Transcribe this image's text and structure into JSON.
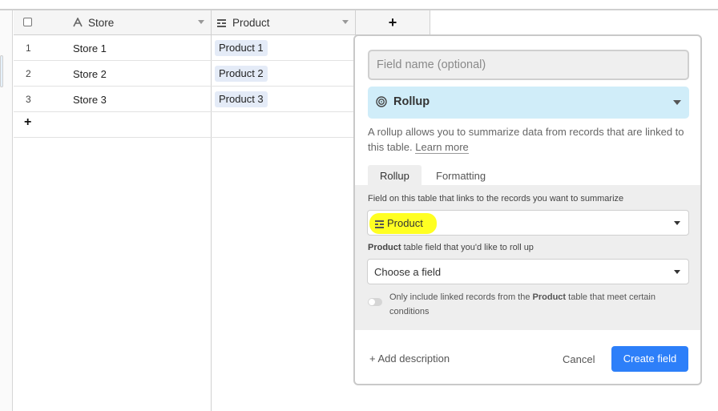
{
  "grid": {
    "header": {
      "store_label": "Store",
      "product_label": "Product",
      "add_column": "+"
    },
    "rows": [
      {
        "num": "1",
        "store": "Store 1",
        "product": "Product 1"
      },
      {
        "num": "2",
        "store": "Store 2",
        "product": "Product 2"
      },
      {
        "num": "3",
        "store": "Store 3",
        "product": "Product 3"
      }
    ],
    "add_row": "+"
  },
  "dialog": {
    "field_name_placeholder": "Field name (optional)",
    "field_type": "Rollup",
    "description": "A rollup allows you to summarize data from records that are linked to this table.",
    "learn_more": "Learn more",
    "tabs": [
      "Rollup",
      "Formatting"
    ],
    "link_field_label": "Field on this table that links to the records you want to summarize",
    "link_field_value": "Product",
    "rollup_field_label_bold": "Product",
    "rollup_field_label_rest": " table field that you'd like to roll up",
    "rollup_field_placeholder": "Choose a field",
    "condition_prefix": "Only include linked records from the ",
    "condition_bold": "Product",
    "condition_suffix": " table that meet certain conditions",
    "add_description": "+ Add description",
    "cancel": "Cancel",
    "create": "Create field"
  },
  "colors": {
    "primary_button": "#2d7ff9",
    "type_select_bg": "#d0edf9",
    "highlight": "#ffff22",
    "linked_pill_bg": "#e4ebf7"
  },
  "icons": [
    "checkbox-icon",
    "text-field-icon",
    "linked-record-icon",
    "rollup-icon",
    "dropdown-caret-icon"
  ]
}
